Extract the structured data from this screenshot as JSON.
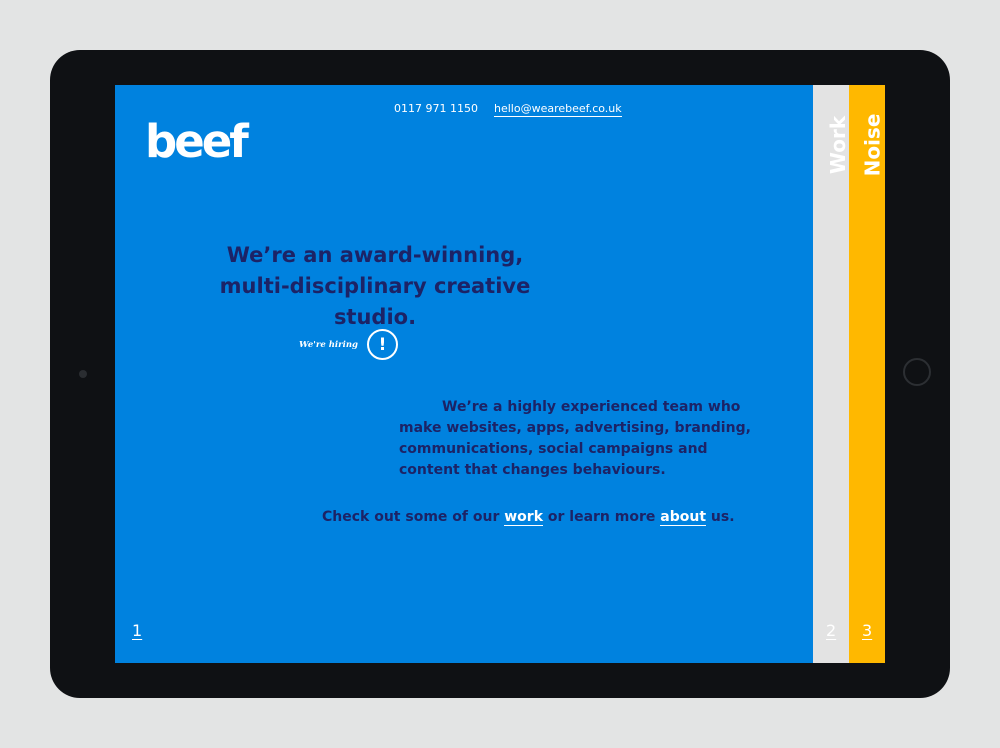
{
  "header": {
    "phone": "0117 971 1150",
    "email": "hello@wearebeef.co.uk"
  },
  "logo": {
    "text": "beef"
  },
  "main": {
    "headline_line1": "We’re an award-winning,",
    "headline_line2": "multi-disciplinary creative studio.",
    "hiring_label": "We're hiring",
    "hiring_icon": "!",
    "description": "We’re a highly experienced team who make websites, apps, advertising, branding, communications, social campaigns and content that changes behaviours.",
    "cta_prefix": "Check out some of our",
    "cta_work": "work",
    "cta_middle": "or learn more",
    "cta_about": "about",
    "cta_suffix": "us."
  },
  "panels": {
    "page1": "1",
    "work_label": "Work",
    "page2": "2",
    "noise_label": "Noise",
    "page3": "3"
  },
  "colors": {
    "main_bg": "#0082df",
    "work_bg": "#e3e3e3",
    "noise_bg": "#ffb800",
    "text_dark": "#1c2366",
    "device": "#0f1114"
  }
}
